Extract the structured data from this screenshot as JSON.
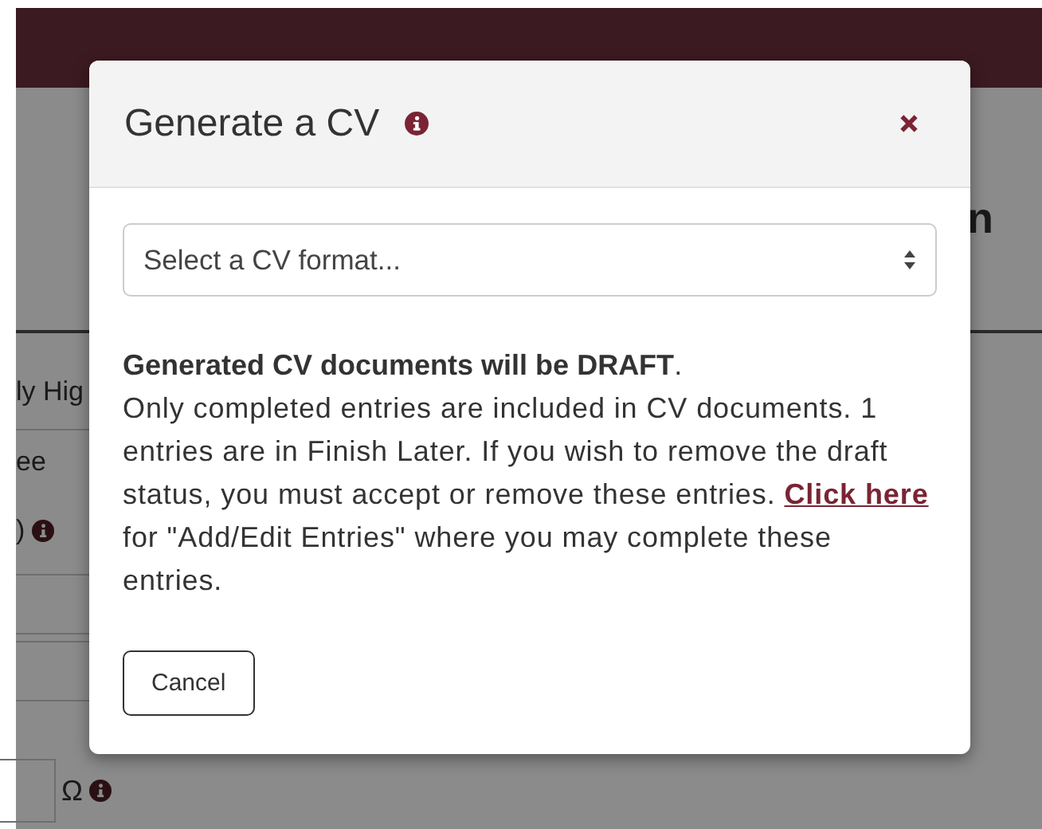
{
  "page": {
    "heading_fragment": "n",
    "items": [
      {
        "kind": "text",
        "text": "ly Hig"
      },
      {
        "kind": "row",
        "text": "ee"
      },
      {
        "kind": "info",
        "text": ")"
      },
      {
        "kind": "field"
      },
      {
        "kind": "field"
      },
      {
        "kind": "input-info",
        "text": "Ω"
      }
    ]
  },
  "dialog": {
    "title": "Generate a CV",
    "select": {
      "placeholder": "Select a CV format..."
    },
    "lead": "**Generated CV documents will be DRAFT**.",
    "body": "Only completed entries are included in CV documents. 1 entries are in Finish Later. If you wish to remove the draft status, you must accept or remove these entries.",
    "link": "Click here",
    "after_link": "for \"Add/Edit Entries\" where you may complete these entries.",
    "buttons": [
      "Cancel"
    ]
  }
}
